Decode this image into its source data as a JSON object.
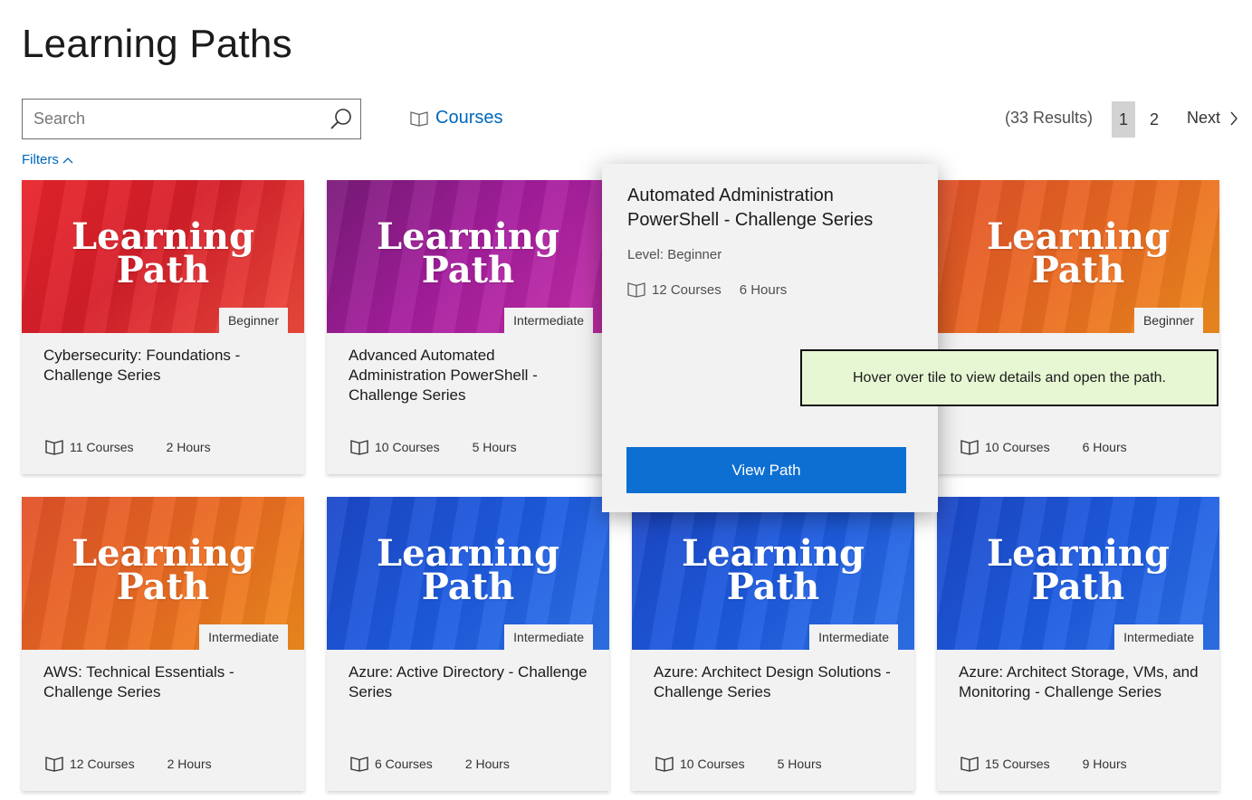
{
  "page": {
    "title": "Learning Paths"
  },
  "search": {
    "placeholder": "Search"
  },
  "toolbar": {
    "courses_label": "Courses",
    "filters_label": "Filters"
  },
  "pagination": {
    "results": "(33 Results)",
    "pages": [
      "1",
      "2"
    ],
    "active_page": "1",
    "next_label": "Next"
  },
  "colors": {
    "accent": "#0067b8",
    "button": "#0e6fd2",
    "tooltip_bg": "#e7f7d3",
    "card_bg": "#f2f2f2"
  },
  "banner_text": {
    "line1": "Learning",
    "line2": "Path"
  },
  "cards": [
    {
      "title": "Cybersecurity: Foundations - Challenge Series",
      "level": "Beginner",
      "courses": "11 Courses",
      "hours": "2 Hours",
      "theme": "red"
    },
    {
      "title": "Advanced Automated Administration PowerShell - Challenge Series",
      "level": "Intermediate",
      "courses": "10 Courses",
      "hours": "5 Hours",
      "theme": "purple"
    },
    {
      "title": "",
      "level": "Beginner",
      "courses": "10 Courses",
      "hours": "6 Hours",
      "theme": "orange"
    },
    {
      "title": "AWS: Technical Essentials - Challenge Series",
      "level": "Intermediate",
      "courses": "12 Courses",
      "hours": "2 Hours",
      "theme": "orange"
    },
    {
      "title": "Azure: Active Directory - Challenge Series",
      "level": "Intermediate",
      "courses": "6 Courses",
      "hours": "2 Hours",
      "theme": "blue"
    },
    {
      "title": "Azure: Architect Design Solutions - Challenge Series",
      "level": "Intermediate",
      "courses": "10 Courses",
      "hours": "5 Hours",
      "theme": "blue"
    },
    {
      "title": "Azure: Architect Storage, VMs, and Monitoring - Challenge Series",
      "level": "Intermediate",
      "courses": "15 Courses",
      "hours": "9 Hours",
      "theme": "blue"
    }
  ],
  "popup": {
    "title": "Automated Administration PowerShell - Challenge Series",
    "level": "Level: Beginner",
    "courses": "12 Courses",
    "hours": "6 Hours",
    "button_label": "View Path"
  },
  "tooltip": {
    "text": "Hover over tile to view details and open the path."
  }
}
